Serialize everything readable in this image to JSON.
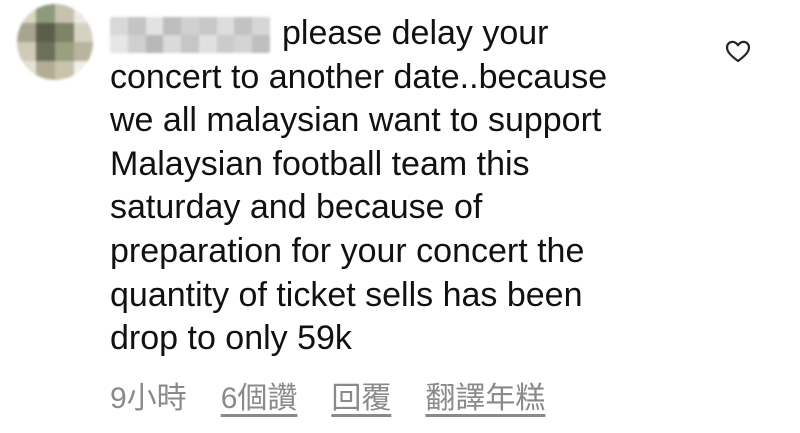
{
  "comment": {
    "username": "",
    "lines": [
      "please delay your",
      "concert to another date..because",
      "we all malaysian want to support",
      "Malaysian football team this",
      "saturday and because of",
      "preparation for your concert the",
      "quantity of ticket sells has been",
      "drop to only 59k"
    ]
  },
  "meta": {
    "time": "9小時",
    "likes": "6個讚",
    "reply": "回覆",
    "translate": "翻譯年糕"
  },
  "icons": {
    "like": "heart-outline-icon"
  },
  "colors": {
    "text": "#111111",
    "meta_text": "#8a8a8a"
  }
}
